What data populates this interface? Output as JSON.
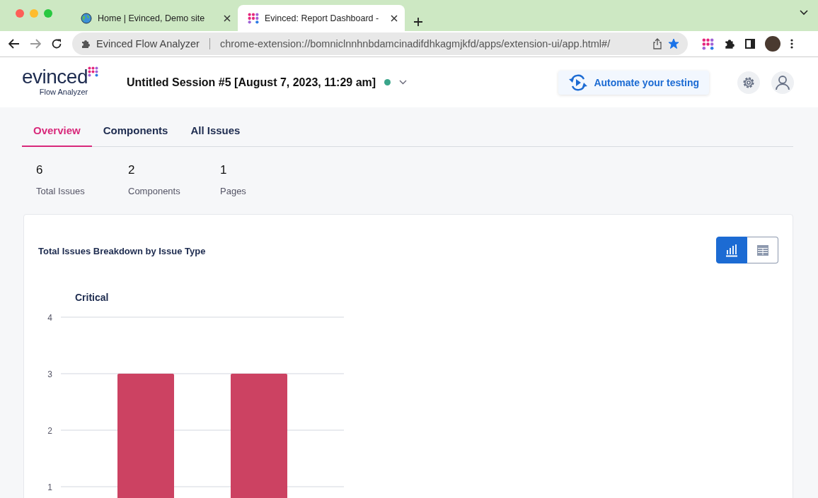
{
  "browser": {
    "tabs": [
      {
        "title": "Home | Evinced, Demo site",
        "selected": false
      },
      {
        "title": "Evinced: Report Dashboard -",
        "selected": true
      }
    ],
    "omnibox": {
      "extension_name": "Evinced Flow Analyzer",
      "url": "chrome-extension://bomniclnnhnbdamcinadifdhkagmjkfd/apps/extension-ui/app.html#/",
      "bookmarked": true
    }
  },
  "header": {
    "logo": "evinced",
    "logo_subtitle": "Flow Analyzer",
    "session_title": "Untitled Session #5 [August 7, 2023, 11:29 am]",
    "automate_button": "Automate your testing"
  },
  "nav_tabs": [
    {
      "label": "Overview",
      "selected": true
    },
    {
      "label": "Components",
      "selected": false
    },
    {
      "label": "All Issues",
      "selected": false
    }
  ],
  "stats": [
    {
      "value": "6",
      "label": "Total Issues"
    },
    {
      "value": "2",
      "label": "Components"
    },
    {
      "value": "1",
      "label": "Pages"
    }
  ],
  "card": {
    "title": "Total Issues Breakdown by Issue Type",
    "view_toggle": [
      {
        "kind": "chart",
        "selected": true
      },
      {
        "kind": "table",
        "selected": false
      }
    ],
    "chart_data": {
      "type": "bar",
      "grid": true,
      "title": "Critical",
      "values": [
        3,
        3
      ],
      "ylim": [
        0,
        4
      ],
      "yticks": [
        1,
        2,
        3,
        4
      ]
    }
  }
}
